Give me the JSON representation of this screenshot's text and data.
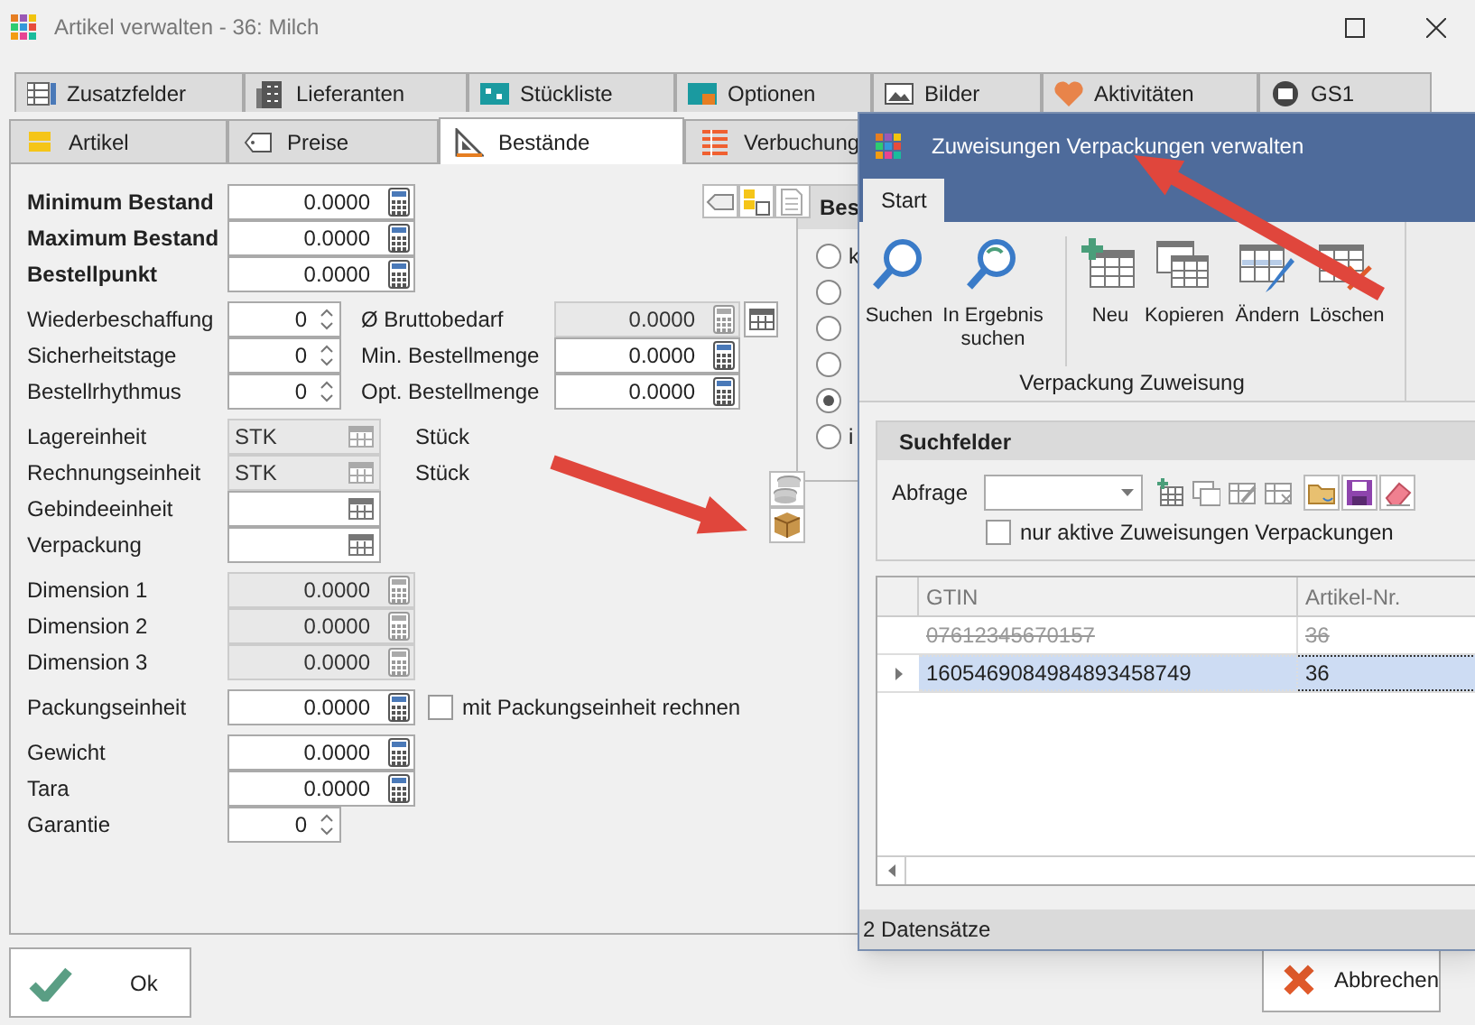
{
  "window": {
    "title": "Artikel verwalten - 36: Milch"
  },
  "tabs_row_1": [
    {
      "label": "Zusatzfelder",
      "selected": false
    },
    {
      "label": "Lieferanten",
      "selected": false
    },
    {
      "label": "Stückliste",
      "selected": false
    },
    {
      "label": "Optionen",
      "selected": false
    },
    {
      "label": "Bilder",
      "selected": false
    },
    {
      "label": "Aktivitäten",
      "selected": false
    },
    {
      "label": "GS1",
      "selected": false
    }
  ],
  "tabs_row_2": [
    {
      "label": "Artikel",
      "selected": false
    },
    {
      "label": "Preise",
      "selected": false
    },
    {
      "label": "Bestände",
      "selected": true
    },
    {
      "label": "Verbuchung",
      "selected": false
    }
  ],
  "field_groups": [
    [
      {
        "label": "Minimum Bestand",
        "kind": "calc",
        "value": "0.0000",
        "bold": true,
        "disabled": false
      },
      {
        "label": "Maximum Bestand",
        "kind": "calc",
        "value": "0.0000",
        "bold": true,
        "disabled": false
      },
      {
        "label": "Bestellpunkt",
        "kind": "calc",
        "value": "0.0000",
        "bold": true,
        "disabled": false
      }
    ],
    [
      {
        "label": "Wiederbeschaffung",
        "kind": "spin",
        "value": "0",
        "bold": false,
        "disabled": false,
        "pair": {
          "label": "Ø Bruttobedarf",
          "value": "0.0000",
          "disabled": true
        }
      },
      {
        "label": "Sicherheitstage",
        "kind": "spin",
        "value": "0",
        "bold": false,
        "disabled": false,
        "pair": {
          "label": "Min. Bestellmenge",
          "value": "0.0000",
          "disabled": false
        }
      },
      {
        "label": "Bestellrhythmus",
        "kind": "spin",
        "value": "0",
        "bold": false,
        "disabled": false,
        "pair": {
          "label": "Opt. Bestellmenge",
          "value": "0.0000",
          "disabled": false
        }
      }
    ],
    [
      {
        "label": "Lagereinheit",
        "kind": "lookup",
        "value": "STK",
        "bold": false,
        "disabled": true,
        "unit_text": "Stück"
      },
      {
        "label": "Rechnungseinheit",
        "kind": "lookup",
        "value": "STK",
        "bold": false,
        "disabled": true,
        "unit_text": "Stück"
      },
      {
        "label": "Gebindeeinheit",
        "kind": "lookup",
        "bold": false,
        "disabled": false
      },
      {
        "label": "Verpackung",
        "kind": "lookup",
        "bold": false,
        "disabled": false
      }
    ],
    [
      {
        "label": "Dimension 1",
        "kind": "calc",
        "value": "0.0000",
        "bold": false,
        "disabled": true
      },
      {
        "label": "Dimension 2",
        "kind": "calc",
        "value": "0.0000",
        "bold": false,
        "disabled": true
      },
      {
        "label": "Dimension 3",
        "kind": "calc",
        "value": "0.0000",
        "bold": false,
        "disabled": true
      }
    ],
    [
      {
        "label": "Packungseinheit",
        "kind": "calc",
        "value": "0.0000",
        "bold": false,
        "disabled": false,
        "checkbox": {
          "label": "mit Packungseinheit rechnen",
          "checked": false
        }
      }
    ],
    [
      {
        "label": "Gewicht",
        "kind": "calc",
        "value": "0.0000",
        "bold": false,
        "disabled": false
      },
      {
        "label": "Tara",
        "kind": "calc",
        "value": "0.0000",
        "bold": false,
        "disabled": false
      },
      {
        "label": "Garantie",
        "kind": "spin",
        "value": "0",
        "bold": false,
        "disabled": false
      }
    ]
  ],
  "side_group": {
    "title": "Bes",
    "options": [
      {
        "label": "k",
        "selected": false
      },
      {
        "selected": false
      },
      {
        "selected": false
      },
      {
        "selected": false
      },
      {
        "selected": true
      },
      {
        "label": "i",
        "selected": false
      }
    ]
  },
  "buttons": {
    "ok": "Ok",
    "cancel": "Abbrechen"
  },
  "dialog": {
    "title": "Zuweisungen Verpackungen verwalten",
    "ribbon_tabs": [
      {
        "label": "Start",
        "selected": true
      }
    ],
    "ribbon_buttons": [
      {
        "label": "Suchen"
      },
      {
        "label": "In Ergebnis suchen"
      },
      {
        "label": "Neu"
      },
      {
        "label": "Kopieren"
      },
      {
        "label": "Ändern"
      },
      {
        "label": "Löschen"
      }
    ],
    "ribbon_group": "Verpackung Zuweisung",
    "search_panel": {
      "title": "Suchfelder",
      "query_label": "Abfrage",
      "checkbox": {
        "label": "nur aktive Zuweisungen Verpackungen",
        "checked": false
      }
    },
    "table": {
      "columns": [
        "GTIN",
        "Artikel-Nr."
      ],
      "rows": [
        {
          "cells": [
            "07612345670157",
            "36"
          ],
          "active": false,
          "selected": false
        },
        {
          "cells": [
            "1605469084984893458749",
            "36"
          ],
          "active": true,
          "selected": true
        }
      ]
    },
    "status_bar": "2 Datensätze"
  }
}
